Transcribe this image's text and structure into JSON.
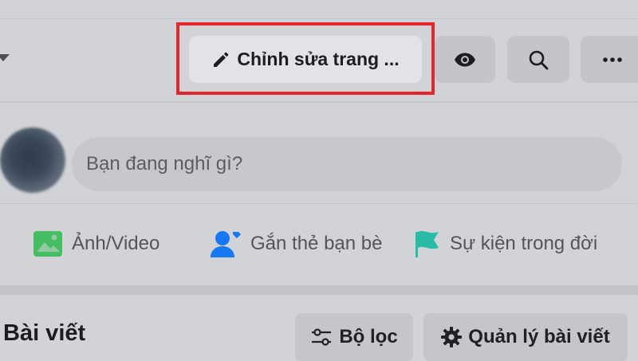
{
  "header": {
    "edit_button_label": "Chỉnh sửa trang ...",
    "view_as_icon": "eye-icon",
    "search_icon": "search-icon",
    "more_icon": "more-icon"
  },
  "composer": {
    "placeholder": "Bạn đang nghĩ gì?"
  },
  "actions": [
    {
      "label": "Ảnh/Video",
      "icon": "photo-icon",
      "color": "#45bd62"
    },
    {
      "label": "Gắn thẻ bạn bè",
      "icon": "tag-friends-icon",
      "color": "#1877f2"
    },
    {
      "label": "Sự kiện trong đời",
      "icon": "flag-icon",
      "color": "#2abba7"
    }
  ],
  "posts": {
    "title": "Bài viết",
    "filter_label": "Bộ lọc",
    "manage_label": "Quản lý bài viết"
  },
  "colors": {
    "highlight": "#e3262a",
    "overlay_bg": "#d2d3d7"
  }
}
